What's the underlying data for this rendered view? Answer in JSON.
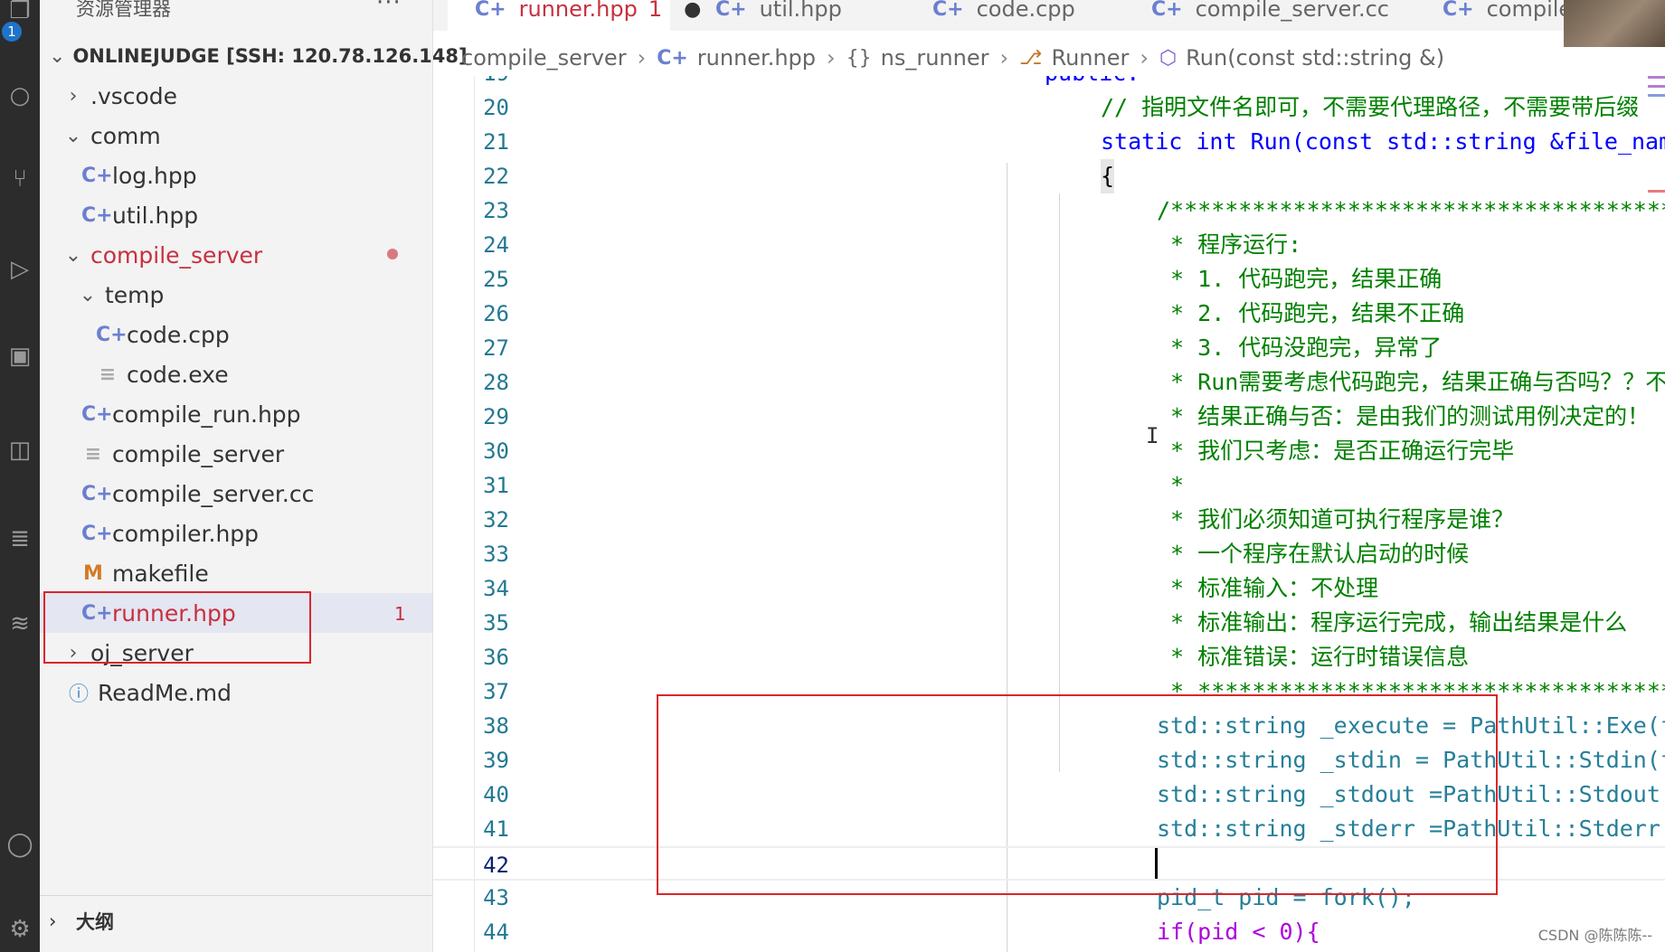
{
  "sidebar": {
    "header": "资源管理器",
    "root": "ONLINEJUDGE [SSH: 120.78.126.148]",
    "items": [
      {
        "label": ".vscode",
        "type": "folder",
        "expanded": false
      },
      {
        "label": "comm",
        "type": "folder",
        "expanded": true
      },
      {
        "label": "log.hpp",
        "type": "cpp"
      },
      {
        "label": "util.hpp",
        "type": "cpp"
      },
      {
        "label": "compile_server",
        "type": "folder",
        "expanded": true
      },
      {
        "label": "temp",
        "type": "folder",
        "expanded": true
      },
      {
        "label": "code.cpp",
        "type": "cpp"
      },
      {
        "label": "code.exe",
        "type": "text"
      },
      {
        "label": "compile_run.hpp",
        "type": "cpp"
      },
      {
        "label": "compile_server",
        "type": "text"
      },
      {
        "label": "compile_server.cc",
        "type": "cpp"
      },
      {
        "label": "compiler.hpp",
        "type": "cpp"
      },
      {
        "label": "makefile",
        "type": "makefile",
        "icon_letter": "M"
      },
      {
        "label": "runner.hpp",
        "type": "cpp",
        "badge": "1"
      },
      {
        "label": "oj_server",
        "type": "folder",
        "expanded": false
      },
      {
        "label": "ReadMe.md",
        "type": "info"
      }
    ],
    "outline": "大纲"
  },
  "tabs": [
    {
      "label": "runner.hpp",
      "count": "1",
      "active": true,
      "modified_dot": "●"
    },
    {
      "label": "util.hpp"
    },
    {
      "label": "code.cpp"
    },
    {
      "label": "compile_server.cc"
    },
    {
      "label": "compiler"
    }
  ],
  "breadcrumb": [
    "compile_server",
    "runner.hpp",
    "ns_runner",
    "Runner",
    "Run(const std::string &)"
  ],
  "code": [
    {
      "n": "19",
      "t": "public:"
    },
    {
      "n": "20",
      "t": "// 指明文件名即可，不需要代理路径，不需要带后缀"
    },
    {
      "n": "21",
      "t": "static int Run(const std::string &file_name)"
    },
    {
      "n": "22",
      "t": "{"
    },
    {
      "n": "23",
      "t": "/*******************************************"
    },
    {
      "n": "24",
      "t": " * 程序运行:"
    },
    {
      "n": "25",
      "t": " * 1. 代码跑完，结果正确"
    },
    {
      "n": "26",
      "t": " * 2. 代码跑完，结果不正确"
    },
    {
      "n": "27",
      "t": " * 3. 代码没跑完，异常了"
    },
    {
      "n": "28",
      "t": " * Run需要考虑代码跑完，结果正确与否吗？？不考虑！"
    },
    {
      "n": "29",
      "t": " * 结果正确与否：是由我们的测试用例决定的！"
    },
    {
      "n": "30",
      "t": " * 我们只考虑：是否正确运行完毕"
    },
    {
      "n": "31",
      "t": " *"
    },
    {
      "n": "32",
      "t": " * 我们必须知道可执行程序是谁？"
    },
    {
      "n": "33",
      "t": " * 一个程序在默认启动的时候"
    },
    {
      "n": "34",
      "t": " * 标准输入：不处理"
    },
    {
      "n": "35",
      "t": " * 标准输出：程序运行完成，输出结果是什么"
    },
    {
      "n": "36",
      "t": " * 标准错误：运行时错误信息"
    },
    {
      "n": "37",
      "t": " * *****************************************/"
    },
    {
      "n": "38",
      "t": "std::string _execute = PathUtil::Exe(file_name);"
    },
    {
      "n": "39",
      "t": "std::string _stdin = PathUtil::Stdin(file_name);"
    },
    {
      "n": "40",
      "t": "std::string _stdout =PathUtil::Stdout(file_name);"
    },
    {
      "n": "41",
      "t": "std::string _stderr =PathUtil::Stderr(file_name);"
    },
    {
      "n": "42",
      "t": ""
    },
    {
      "n": "43",
      "t": "pid_t pid = fork();"
    },
    {
      "n": "44",
      "t": "if(pid < 0){"
    }
  ],
  "watermark": "CSDN @陈陈陈--"
}
